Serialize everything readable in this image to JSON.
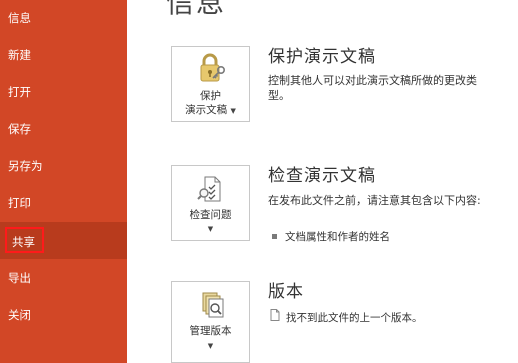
{
  "sidebar": {
    "items": [
      {
        "label": "信息"
      },
      {
        "label": "新建"
      },
      {
        "label": "打开"
      },
      {
        "label": "保存"
      },
      {
        "label": "另存为"
      },
      {
        "label": "打印"
      },
      {
        "label": "共享"
      },
      {
        "label": "导出"
      },
      {
        "label": "关闭"
      }
    ]
  },
  "main": {
    "title": "信息",
    "sections": [
      {
        "button_line1": "保护",
        "button_line2": "演示文稿",
        "title": "保护演示文稿",
        "description": "控制其他人可以对此演示文稿所做的更改类型。",
        "icon": "lock-key-icon"
      },
      {
        "button_label": "检查问题",
        "title": "检查演示文稿",
        "description": "在发布此文件之前，请注意其包含以下内容:",
        "bullet": "文档属性和作者的姓名",
        "icon": "inspect-document-icon"
      },
      {
        "button_label": "管理版本",
        "title": "版本",
        "info": "找不到此文件的上一个版本。",
        "icon": "manage-versions-icon"
      }
    ]
  },
  "colors": {
    "sidebar_bg": "#d24726",
    "sidebar_active_bg": "#b83b1d",
    "highlight_border": "#ff1a1a"
  }
}
